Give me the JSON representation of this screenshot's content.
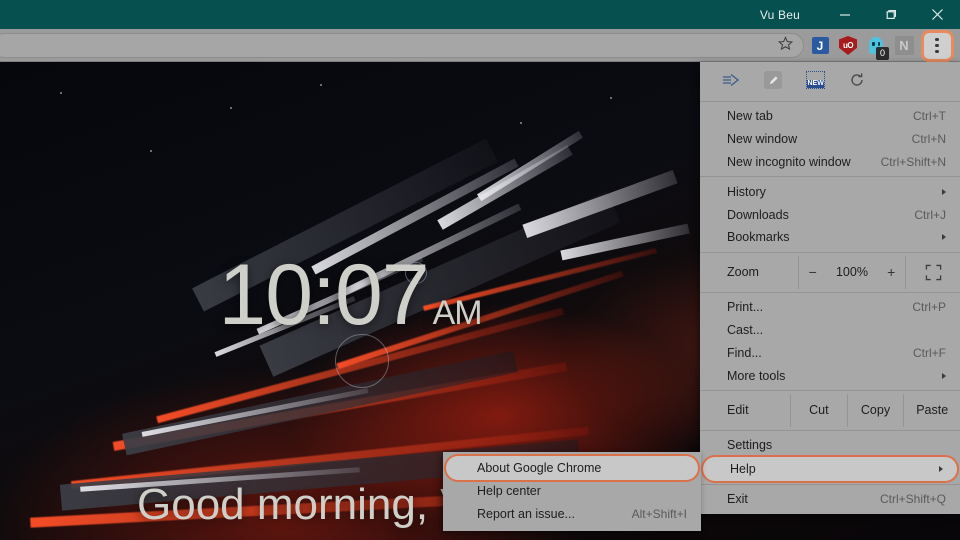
{
  "window": {
    "profile_name": "Vu Beu",
    "minimize_label": "Minimize",
    "maximize_label": "Restore",
    "close_label": "Close"
  },
  "toolbar": {
    "bookmark_icon": "star-icon",
    "extensions": [
      {
        "name": "jira-extension-icon",
        "glyph": "J"
      },
      {
        "name": "ublock-origin-icon",
        "glyph": "uO"
      },
      {
        "name": "ghostery-icon",
        "badge": "0"
      },
      {
        "name": "notion-extension-icon",
        "glyph": "N"
      }
    ],
    "menu_button": "chrome-menu-button"
  },
  "page": {
    "clock_time": "10:07",
    "clock_period": "AM",
    "greeting": "Good morning, Vu Beu"
  },
  "menu": {
    "top_icons": [
      {
        "name": "forward-arrow-icon"
      },
      {
        "name": "edit-pencil-icon"
      },
      {
        "name": "new-screenshot-icon",
        "label": "NEW"
      },
      {
        "name": "refresh-icon"
      }
    ],
    "groups": [
      {
        "items": [
          {
            "label": "New tab",
            "accel": "Ctrl+T"
          },
          {
            "label": "New window",
            "accel": "Ctrl+N"
          },
          {
            "label": "New incognito window",
            "accel": "Ctrl+Shift+N"
          }
        ]
      },
      {
        "items": [
          {
            "label": "History",
            "accel": "",
            "submenu": true
          },
          {
            "label": "Downloads",
            "accel": "Ctrl+J"
          },
          {
            "label": "Bookmarks",
            "accel": "",
            "submenu": true
          }
        ]
      }
    ],
    "zoom": {
      "label": "Zoom",
      "minus": "−",
      "value": "100%",
      "plus": "+",
      "fullscreen_icon": "fullscreen-icon"
    },
    "tools_group": [
      {
        "label": "Print...",
        "accel": "Ctrl+P"
      },
      {
        "label": "Cast...",
        "accel": ""
      },
      {
        "label": "Find...",
        "accel": "Ctrl+F"
      },
      {
        "label": "More tools",
        "accel": "",
        "submenu": true
      }
    ],
    "edit_row": {
      "label": "Edit",
      "cut": "Cut",
      "copy": "Copy",
      "paste": "Paste"
    },
    "bottom_group": [
      {
        "label": "Settings",
        "accel": ""
      },
      {
        "label": "Help",
        "accel": "",
        "submenu": true,
        "highlighted": true
      }
    ],
    "exit": {
      "label": "Exit",
      "accel": "Ctrl+Shift+Q"
    }
  },
  "help_submenu": {
    "items": [
      {
        "label": "About Google Chrome",
        "accel": "",
        "highlighted": true
      },
      {
        "label": "Help center",
        "accel": ""
      },
      {
        "label": "Report an issue...",
        "accel": "Alt+Shift+I"
      }
    ]
  },
  "colors": {
    "titlebar": "#075050",
    "toolbar": "#9b9b9b",
    "menu_bg": "#a8a8a8",
    "highlight_ring": "#d9714a"
  }
}
